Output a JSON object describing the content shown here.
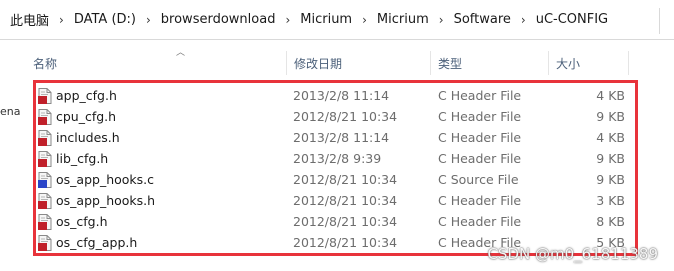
{
  "breadcrumb": [
    "此电脑",
    "DATA (D:)",
    "browserdownload",
    "Micrium",
    "Micrium",
    "Software",
    "uC-CONFIG"
  ],
  "columns": {
    "name": "名称",
    "date": "修改日期",
    "type": "类型",
    "size": "大小"
  },
  "side_fragment": "ena",
  "files": [
    {
      "name": "app_cfg.h",
      "date": "2013/2/8 11:14",
      "type": "C Header File",
      "size": "4 KB",
      "icon": "h-file-icon"
    },
    {
      "name": "cpu_cfg.h",
      "date": "2012/8/21 10:34",
      "type": "C Header File",
      "size": "9 KB",
      "icon": "h-file-icon"
    },
    {
      "name": "includes.h",
      "date": "2013/2/8 11:14",
      "type": "C Header File",
      "size": "4 KB",
      "icon": "h-file-icon"
    },
    {
      "name": "lib_cfg.h",
      "date": "2013/2/8 9:39",
      "type": "C Header File",
      "size": "9 KB",
      "icon": "h-file-icon"
    },
    {
      "name": "os_app_hooks.c",
      "date": "2012/8/21 10:34",
      "type": "C Source File",
      "size": "9 KB",
      "icon": "c-file-icon"
    },
    {
      "name": "os_app_hooks.h",
      "date": "2012/8/21 10:34",
      "type": "C Header File",
      "size": "3 KB",
      "icon": "h-file-icon"
    },
    {
      "name": "os_cfg.h",
      "date": "2012/8/21 10:34",
      "type": "C Header File",
      "size": "8 KB",
      "icon": "h-file-icon"
    },
    {
      "name": "os_cfg_app.h",
      "date": "2012/8/21 10:34",
      "type": "C Header File",
      "size": "5 KB",
      "icon": "h-file-icon"
    }
  ],
  "watermark": "CSDN @m0_61811389",
  "colors": {
    "highlight_border": "#e8333b",
    "header_text": "#4c607a",
    "h_icon": "#c0202a",
    "c_icon": "#2a45c8"
  }
}
